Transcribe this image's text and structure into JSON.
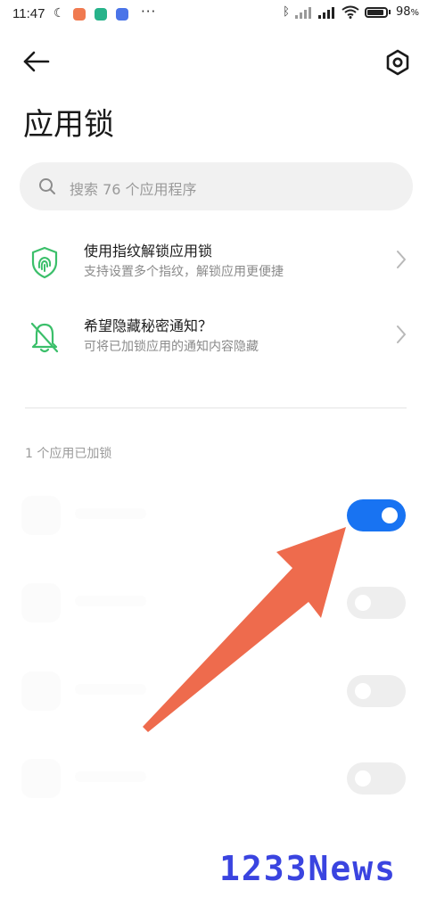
{
  "status_bar": {
    "time": "11:47",
    "battery_percent": "98",
    "battery_suffix": "%",
    "notification_colors": [
      "#f07a50",
      "#27b38a",
      "#4a74e8"
    ]
  },
  "header": {
    "back_icon": "arrow-left-icon",
    "settings_icon": "hexagon-gear-icon",
    "title": "应用锁"
  },
  "search": {
    "placeholder": "搜索 76 个应用程序"
  },
  "options": [
    {
      "title": "使用指纹解锁应用锁",
      "subtitle": "支持设置多个指纹，解锁应用更便捷",
      "icon": "fingerprint-icon"
    },
    {
      "title": "希望隐藏秘密通知？",
      "subtitle": "可将已加锁应用的通知内容隐藏",
      "icon": "bell-off-icon"
    }
  ],
  "section": {
    "locked_count_label": "1 个应用已加锁"
  },
  "apps": [
    {
      "locked": true
    },
    {
      "locked": false
    },
    {
      "locked": false
    },
    {
      "locked": false
    }
  ],
  "colors": {
    "accent": "#1873f2",
    "option_icon": "#3bbf6a",
    "arrow": "#ee6b4d",
    "watermark": "#3a44e0"
  },
  "watermark": "1233News"
}
